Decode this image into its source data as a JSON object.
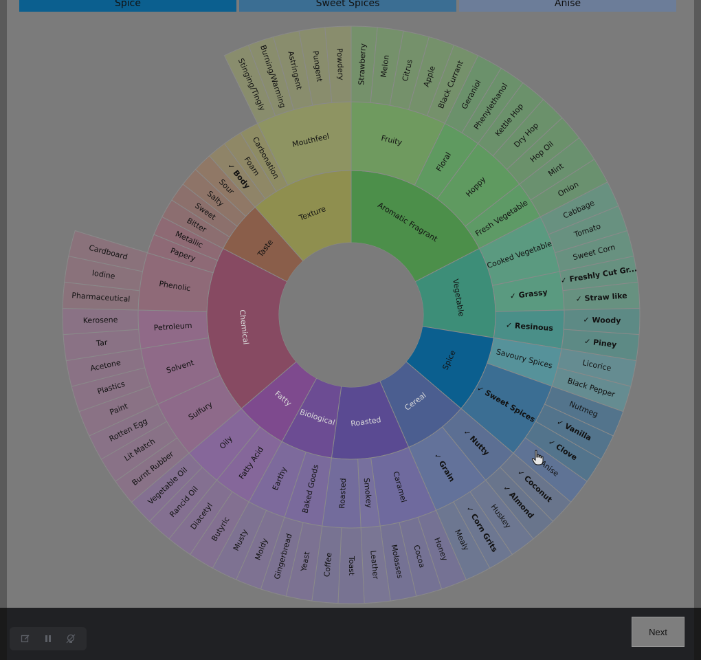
{
  "breadcrumbs": [
    {
      "label": "Spice",
      "color": "#0b5f8f"
    },
    {
      "label": "Sweet Spices",
      "color": "#3b6e93"
    },
    {
      "label": "Anise",
      "color": "#6c7d99"
    }
  ],
  "footer": {
    "next_label": "Next"
  },
  "toolbar": {
    "icons": [
      "edit-icon",
      "pause-icon",
      "lightbulb-icon"
    ]
  },
  "wheel": {
    "categories": [
      {
        "name": "Aromatic Fragrant",
        "color": "#4c8f4a",
        "subs": [
          {
            "name": "Fruity",
            "color": "#6f9a5f",
            "leaves": [
              {
                "name": "Strawberry"
              },
              {
                "name": "Melon"
              },
              {
                "name": "Citrus"
              },
              {
                "name": "Apple"
              },
              {
                "name": "Black Currant"
              }
            ]
          },
          {
            "name": "Floral",
            "color": "#5f9a60",
            "leaves": [
              {
                "name": "Geraniol"
              },
              {
                "name": "Phenylethanol"
              }
            ]
          },
          {
            "name": "Hoppy",
            "color": "#5f9a60",
            "leaves": [
              {
                "name": "Kettle Hop"
              },
              {
                "name": "Dry Hop"
              },
              {
                "name": "Hop Oil"
              }
            ]
          },
          {
            "name": "Fresh Vegetable",
            "color": "#5e9a66",
            "leaves": [
              {
                "name": "Mint"
              },
              {
                "name": "Onion"
              }
            ]
          }
        ]
      },
      {
        "name": "Vegetable",
        "color": "#3d8e78",
        "subs": [
          {
            "name": "Cooked Vegetable",
            "color": "#5b9a80",
            "leaves": [
              {
                "name": "Cabbage"
              },
              {
                "name": "Tomato"
              },
              {
                "name": "Sweet Corn"
              }
            ]
          },
          {
            "name": "Grassy",
            "checked": true,
            "color": "#5a9a80",
            "leaves": [
              {
                "name": "Freshly Cut Gr...",
                "checked": true
              },
              {
                "name": "Straw like",
                "checked": true
              }
            ]
          },
          {
            "name": "Resinous",
            "checked": true,
            "color": "#4a8f88",
            "leaves": [
              {
                "name": "Woody",
                "checked": true
              },
              {
                "name": "Piney",
                "checked": true
              }
            ]
          }
        ]
      },
      {
        "name": "Spice",
        "color": "#0b5f8f",
        "subs": [
          {
            "name": "Savoury Spices",
            "color": "#56929a",
            "leaves": [
              {
                "name": "Licorice"
              },
              {
                "name": "Black Pepper"
              }
            ]
          },
          {
            "name": "Sweet Spices",
            "checked": true,
            "color": "#3b6e93",
            "leaves": [
              {
                "name": "Nutmeg"
              },
              {
                "name": "Vanilla",
                "checked": true
              },
              {
                "name": "Clove",
                "checked": true
              },
              {
                "name": "Anise",
                "highlight": true
              }
            ]
          }
        ]
      },
      {
        "name": "Cereal",
        "color": "#4b5e90",
        "subs": [
          {
            "name": "Nutty",
            "checked": true,
            "color": "#5c6f93",
            "leaves": [
              {
                "name": "Coconut",
                "checked": true
              },
              {
                "name": "Almond",
                "checked": true
              }
            ]
          },
          {
            "name": "Grain",
            "checked": true,
            "color": "#63729a",
            "leaves": [
              {
                "name": "Huskey"
              },
              {
                "name": "Corn Grits",
                "checked": true
              },
              {
                "name": "Mealy"
              }
            ]
          }
        ]
      },
      {
        "name": "Roasted",
        "color": "#5a4a92",
        "subs": [
          {
            "name": "Caramel",
            "color": "#6f6a9e",
            "leaves": [
              {
                "name": "Honey"
              },
              {
                "name": "Cocoa"
              },
              {
                "name": "Molasses"
              }
            ]
          },
          {
            "name": "Smokey",
            "color": "#77709e",
            "leaves": [
              {
                "name": "Leather"
              }
            ]
          },
          {
            "name": "Roasted",
            "color": "#736c9c",
            "leaves": [
              {
                "name": "Toast"
              },
              {
                "name": "Coffee"
              }
            ]
          }
        ]
      },
      {
        "name": "Biological",
        "color": "#6c4c93",
        "subs": [
          {
            "name": "Baked Goods",
            "color": "#7a6a9c",
            "leaves": [
              {
                "name": "Yeast"
              },
              {
                "name": "Gingerbread"
              }
            ]
          },
          {
            "name": "Earthy",
            "color": "#7d6a9c",
            "leaves": [
              {
                "name": "Moldy"
              },
              {
                "name": "Musty"
              }
            ]
          }
        ]
      },
      {
        "name": "Fatty",
        "color": "#7e4a8e",
        "subs": [
          {
            "name": "Fatty Acid",
            "color": "#85679a",
            "leaves": [
              {
                "name": "Butyric"
              },
              {
                "name": "Diacetyl"
              }
            ]
          },
          {
            "name": "Oily",
            "color": "#86679a",
            "leaves": [
              {
                "name": "Rancid Oil"
              },
              {
                "name": "Vegetable Oil"
              }
            ]
          }
        ]
      },
      {
        "name": "Chemical",
        "color": "#874a62",
        "subs": [
          {
            "name": "Sulfury",
            "color": "#8e6a8a",
            "leaves": [
              {
                "name": "Burnt Rubber"
              },
              {
                "name": "Lit Match"
              },
              {
                "name": "Rotten Egg"
              }
            ]
          },
          {
            "name": "Solvent",
            "color": "#8f6a88",
            "leaves": [
              {
                "name": "Paint"
              },
              {
                "name": "Plastics"
              },
              {
                "name": "Acetone"
              }
            ]
          },
          {
            "name": "Petroleum",
            "color": "#906a88",
            "leaves": [
              {
                "name": "Tar"
              },
              {
                "name": "Kerosene"
              }
            ]
          },
          {
            "name": "Phenolic",
            "color": "#8f6a78",
            "leaves": [
              {
                "name": "Pharmaceutical"
              },
              {
                "name": "Iodine"
              },
              {
                "name": "Cardboard"
              }
            ]
          },
          {
            "name": "Papery",
            "color": "#8e6a76",
            "leaves": []
          },
          {
            "name": "Metallic",
            "color": "#8e6a74",
            "leaves": []
          }
        ]
      },
      {
        "name": "Taste",
        "color": "#8a5e4a",
        "subs": [
          {
            "name": "Bitter",
            "color": "#8c6e70",
            "leaves": []
          },
          {
            "name": "Sweet",
            "color": "#8c706c",
            "leaves": []
          },
          {
            "name": "Salty",
            "color": "#8e7468",
            "leaves": []
          },
          {
            "name": "Sour",
            "color": "#907866",
            "leaves": []
          }
        ]
      },
      {
        "name": "Texture",
        "color": "#8f8f4f",
        "subs": [
          {
            "name": "Body",
            "checked": true,
            "color": "#8f8468",
            "leaves": []
          },
          {
            "name": "Foam",
            "color": "#8f8866",
            "leaves": []
          },
          {
            "name": "Carbonation",
            "color": "#8e8c64",
            "leaves": []
          },
          {
            "name": "Mouthfeel",
            "color": "#8e9462",
            "leaves": [
              {
                "name": "Stinging/Tingly"
              },
              {
                "name": "Burning/Warming"
              },
              {
                "name": "Astringent"
              },
              {
                "name": "Pungent"
              },
              {
                "name": "Powdery"
              }
            ]
          }
        ]
      }
    ]
  }
}
